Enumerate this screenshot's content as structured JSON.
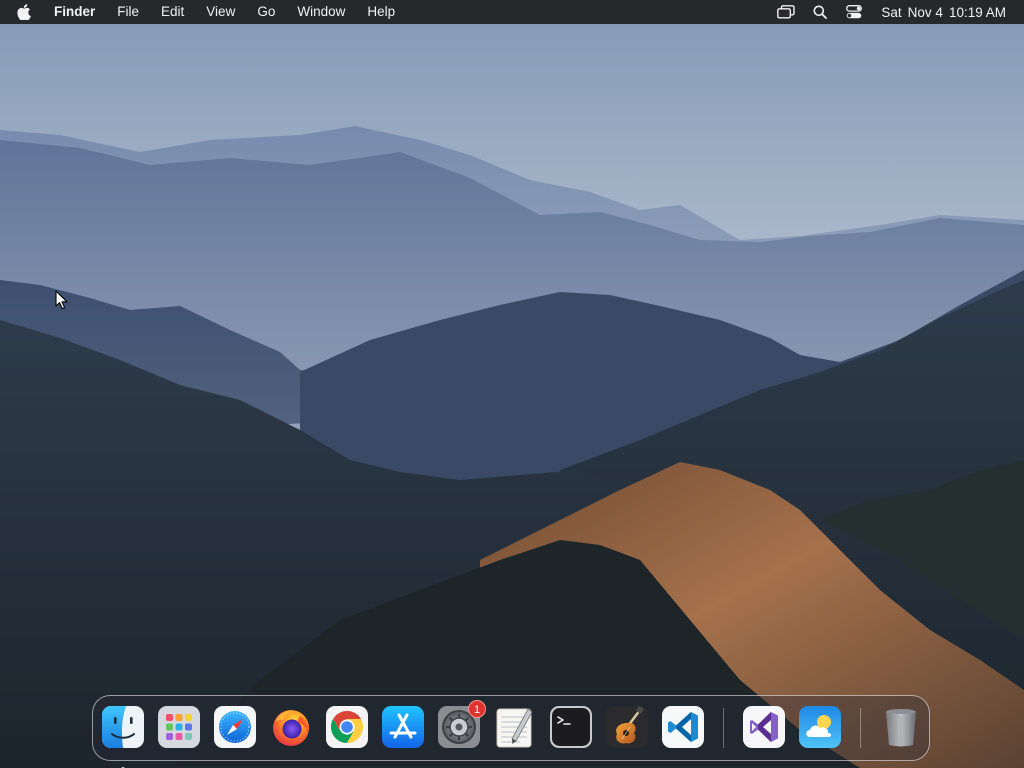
{
  "menubar": {
    "apple_icon": "apple-logo-icon",
    "app_name": "Finder",
    "items": [
      "File",
      "Edit",
      "View",
      "Go",
      "Window",
      "Help"
    ],
    "status_icons": [
      "screen-mirroring-icon",
      "spotlight-search-icon",
      "control-center-icon"
    ],
    "clock": {
      "day": "Sat",
      "date": "Nov 4",
      "time": "10:19 AM"
    }
  },
  "desktop": {
    "wallpaper": "misty-mountain-ridges",
    "colors": {
      "sky_top": "#8fa3bc",
      "sky_bottom": "#c4cbd3",
      "ridge_far": "#6f85a8",
      "ridge_mid": "#3f5275",
      "ridge_dark": "#1f2a33",
      "sunlit_ridge": "#9c6a48"
    }
  },
  "dock": {
    "apps": [
      {
        "name": "Finder",
        "icon": "finder-icon",
        "running": true
      },
      {
        "name": "Launchpad",
        "icon": "launchpad-icon"
      },
      {
        "name": "Safari",
        "icon": "safari-icon"
      },
      {
        "name": "Firefox",
        "icon": "firefox-icon"
      },
      {
        "name": "Chrome",
        "icon": "chrome-icon"
      },
      {
        "name": "App Store",
        "icon": "app-store-icon"
      },
      {
        "name": "System Preferences",
        "icon": "system-preferences-icon",
        "badge": "1"
      },
      {
        "name": "TextEdit",
        "icon": "textedit-icon"
      },
      {
        "name": "Terminal",
        "icon": "terminal-icon"
      },
      {
        "name": "GarageBand",
        "icon": "garageband-icon"
      },
      {
        "name": "Visual Studio Code",
        "icon": "vscode-icon"
      }
    ],
    "recent_apps": [
      {
        "name": "Visual Studio",
        "icon": "visual-studio-icon"
      },
      {
        "name": "Weather",
        "icon": "weather-icon"
      }
    ],
    "trash": {
      "name": "Trash",
      "icon": "trash-icon"
    }
  }
}
